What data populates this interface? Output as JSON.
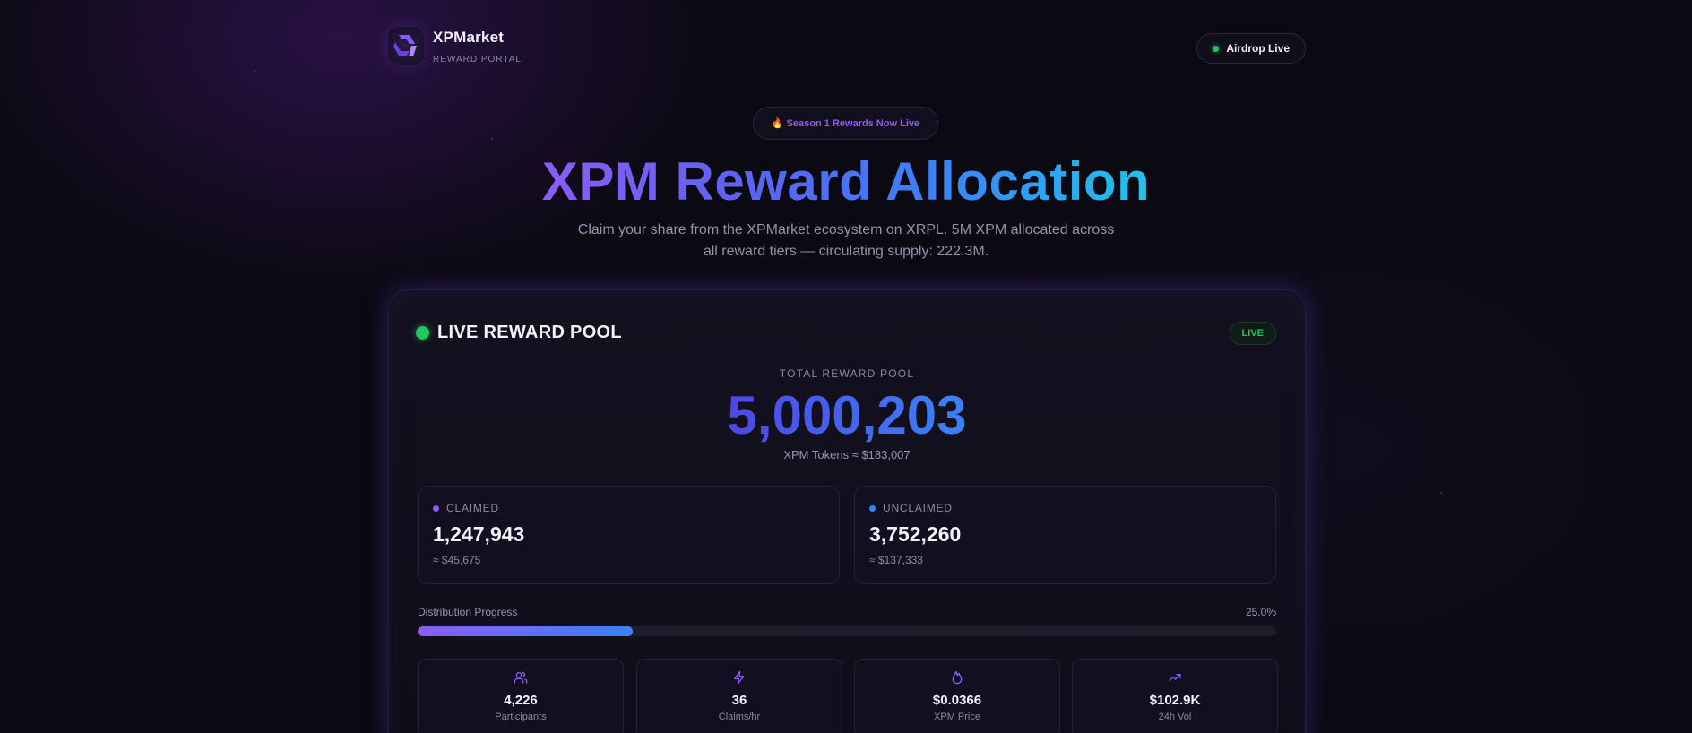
{
  "brand": {
    "name": "XPMarket",
    "subtitle": "REWARD PORTAL"
  },
  "status_pill": {
    "label": "Airdrop Live"
  },
  "hero": {
    "season_badge": "🔥 Season 1 Rewards Now Live",
    "title": "XPM Reward Allocation",
    "subtitle": "Claim your share from the XPMarket ecosystem on XRPL. 5M XPM allocated across all reward tiers — circulating supply: 222.3M."
  },
  "pool": {
    "header": "LIVE REWARD POOL",
    "badge": "LIVE",
    "total_label": "TOTAL REWARD POOL",
    "total_value": "5,000,203",
    "total_sub": "XPM Tokens ≈ $183,007",
    "claimed": {
      "label": "CLAIMED",
      "value": "1,247,943",
      "usd": "≈ $45,675",
      "color": "#8b5cf6"
    },
    "unclaimed": {
      "label": "UNCLAIMED",
      "value": "3,752,260",
      "usd": "≈ $137,333",
      "color": "#3b82f6"
    },
    "progress": {
      "label": "Distribution Progress",
      "percent_text": "25.0%",
      "fraction": 0.25
    }
  },
  "metrics": [
    {
      "icon": "users-icon",
      "value": "4,226",
      "label": "Participants"
    },
    {
      "icon": "lightning-icon",
      "value": "36",
      "label": "Claims/hr"
    },
    {
      "icon": "flame-icon",
      "value": "$0.0366",
      "label": "XPM Price"
    },
    {
      "icon": "trending-up-icon",
      "value": "$102.9K",
      "label": "24h Vol"
    }
  ],
  "colors": {
    "accent_purple": "#8b5cf6",
    "accent_blue": "#3b82f6",
    "live_green": "#22c55e"
  }
}
